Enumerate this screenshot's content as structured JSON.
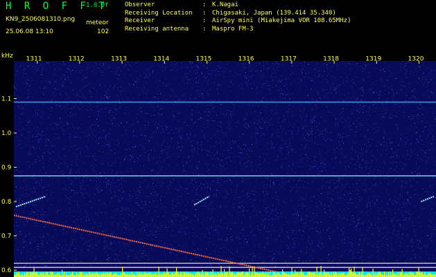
{
  "header": {
    "app_title": "H R O F F T",
    "version": "1.0.0f",
    "filename": "KN9_2506081310.png",
    "datetime": "25.06.08 13:10",
    "mode": "meteor",
    "count": "102"
  },
  "info": {
    "rows": [
      {
        "label": "Observer",
        "value": "K.Nagai"
      },
      {
        "label": "Receiving Location",
        "value": "Chigasaki, Japan (139.414 35.340)"
      },
      {
        "label": "Receiver",
        "value": "AirSpy mini (Miakejima VOR 108.65MHz)"
      },
      {
        "label": "Receiving antenna",
        "value": "Maspro FM-3"
      }
    ]
  },
  "chart_data": {
    "type": "spectrogram",
    "ylabel": "kHz",
    "x_ticks": [
      "1311",
      "1312",
      "1313",
      "1314",
      "1315",
      "1316",
      "1317",
      "1318",
      "1319",
      "1320"
    ],
    "y_ticks": [
      "1.1",
      "1.0",
      "0.9",
      "0.8",
      "0.7",
      "0.6"
    ],
    "ylim": [
      0.58,
      1.21
    ],
    "xlim": [
      1310.45,
      1320.4
    ],
    "lines": [
      {
        "y": 1.09,
        "color": "#39a9ff"
      },
      {
        "y": 0.875,
        "color": "#7de8ff"
      },
      {
        "y": 0.62,
        "color": "#c8c8c8"
      },
      {
        "y": 0.608,
        "color": "#c8c8c8"
      }
    ],
    "trails": [
      {
        "from": [
          1310.45,
          0.76
        ],
        "to": [
          1317.2,
          0.58
        ],
        "color": "#ff6a3a"
      },
      {
        "from": [
          1310.5,
          0.785
        ],
        "to": [
          1311.2,
          0.815
        ],
        "color": "#9fe8ff"
      },
      {
        "from": [
          1314.7,
          0.79
        ],
        "to": [
          1315.05,
          0.815
        ],
        "color": "#9fe8ff"
      },
      {
        "from": [
          1320.05,
          0.8
        ],
        "to": [
          1320.35,
          0.815
        ],
        "color": "#9fe8ff"
      }
    ],
    "colors": {
      "background": "#0a0a5a",
      "noise": "#2a4fc8",
      "baseline": "#ffff00",
      "cyan": "#00e5ff"
    }
  }
}
